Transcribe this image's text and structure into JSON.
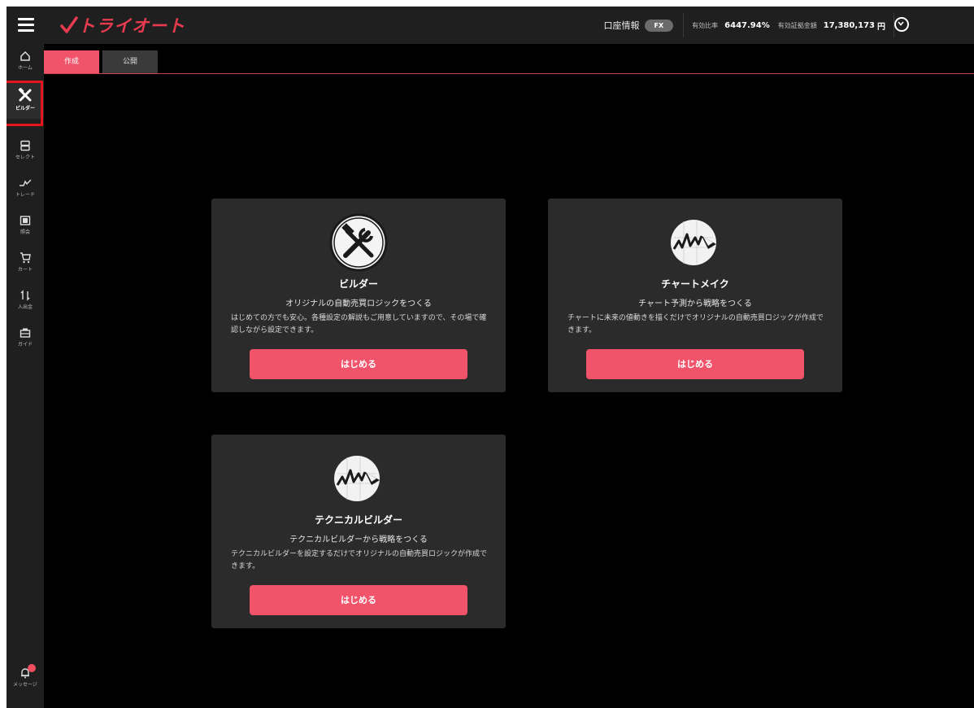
{
  "app": {
    "logo_text": "トライオート"
  },
  "header": {
    "account_label": "口座情報",
    "fx_badge": "FX",
    "margin_ratio_label": "有効比率",
    "margin_ratio_value": "6447.94%",
    "effective_margin_label": "有効証拠金額",
    "effective_margin_value": "17,380,173",
    "effective_margin_unit": "円"
  },
  "sidebar": {
    "items": [
      {
        "label": "ホーム",
        "icon": "home-icon"
      },
      {
        "label": "ビルダー",
        "icon": "tools-icon",
        "active": true
      },
      {
        "label": "セレクト",
        "icon": "select-icon"
      },
      {
        "label": "トレード",
        "icon": "trade-icon"
      },
      {
        "label": "照会",
        "icon": "inquiry-icon"
      },
      {
        "label": "カート",
        "icon": "cart-icon"
      },
      {
        "label": "入出金",
        "icon": "transfer-icon"
      },
      {
        "label": "ガイド",
        "icon": "guide-icon"
      }
    ],
    "message_label": "メッセージ"
  },
  "tabs": [
    {
      "label": "作成",
      "active": true
    },
    {
      "label": "公開",
      "active": false
    }
  ],
  "cards": [
    {
      "icon": "tools-icon",
      "title": "ビルダー",
      "subtitle": "オリジナルの自動売買ロジックをつくる",
      "description": "はじめての方でも安心。各種設定の解説もご用意していますので、その場で確認しながら設定できます。",
      "button_label": "はじめる"
    },
    {
      "icon": "chart-draw-icon",
      "title": "チャートメイク",
      "subtitle": "チャート予測から戦略をつくる",
      "description": "チャートに未来の値動きを描くだけでオリジナルの自動売買ロジックが作成できます。",
      "button_label": "はじめる"
    },
    {
      "icon": "chart-draw-icon",
      "title": "テクニカルビルダー",
      "subtitle": "テクニカルビルダーから戦略をつくる",
      "description": "テクニカルビルダーを設定するだけでオリジナルの自動売買ロジックが作成できます。",
      "button_label": "はじめる"
    }
  ],
  "colors": {
    "accent": "#f0536a",
    "logo": "#e83b4f",
    "highlight": "#e8141b",
    "card_bg": "#2b2b2b"
  }
}
